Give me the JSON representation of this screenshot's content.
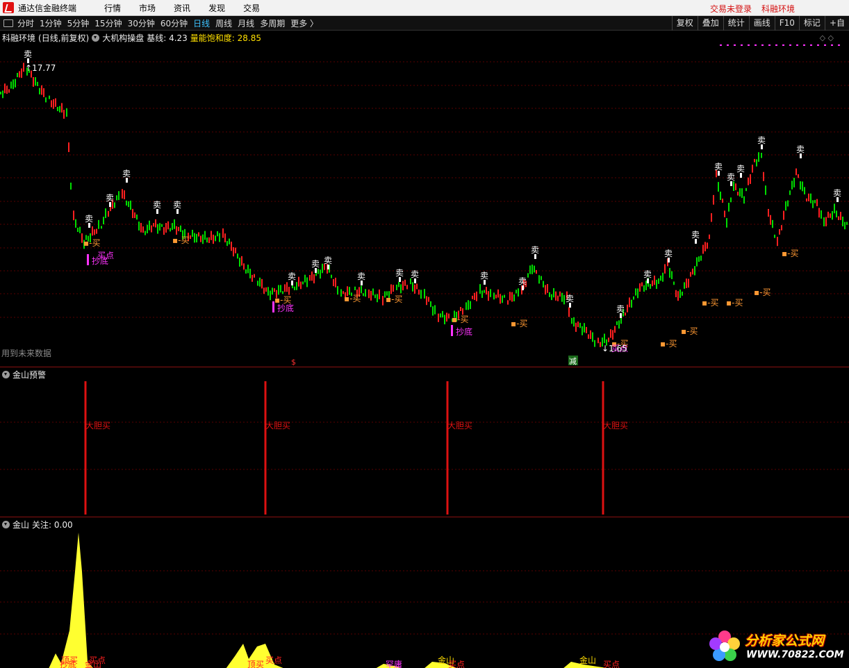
{
  "app": {
    "title": "通达信金融终端",
    "menu": [
      "行情",
      "市场",
      "资讯",
      "发现",
      "交易"
    ],
    "login_status": "交易未登录",
    "instrument": "科融环境"
  },
  "toolbar": {
    "periods": [
      "分时",
      "1分钟",
      "5分钟",
      "15分钟",
      "30分钟",
      "60分钟",
      "日线",
      "周线",
      "月线",
      "多周期",
      "更多 〉"
    ],
    "active_period": "日线",
    "buttons": [
      "复权",
      "叠加",
      "统计",
      "画线",
      "F10",
      "标记",
      "+自"
    ]
  },
  "main_panel": {
    "stock": "科融环境",
    "stock_info": "(日线,前复权)",
    "indicator": "大机构操盘",
    "baseline_label": "基线: 4.23",
    "saturation_label": "量能饱和度: 28.85",
    "future_data_notice": "用到未来数据",
    "high_price": "17.77",
    "low_price": "1.65",
    "signal_labels": [
      "卖",
      "买",
      "抄底",
      "买点",
      "$",
      "减"
    ],
    "colors": {
      "up": "#ff2020",
      "down": "#00dd00",
      "gridline": "#5a0000",
      "buy": "#ff9933",
      "bottom": "#ff33ff"
    }
  },
  "alert_panel": {
    "title": "金山预警",
    "signal_text": "大胆买",
    "signal_color": "#dd1111"
  },
  "js_panel": {
    "title": "金山",
    "focus_label": "关注: 0.00",
    "bottom_labels": [
      "抄底",
      "顶买",
      "金山",
      "买点",
      "罕庸"
    ],
    "area_color": "#ffff30"
  },
  "watermark": {
    "name": "分析家公式网",
    "url": "WWW.70822.COM"
  }
}
